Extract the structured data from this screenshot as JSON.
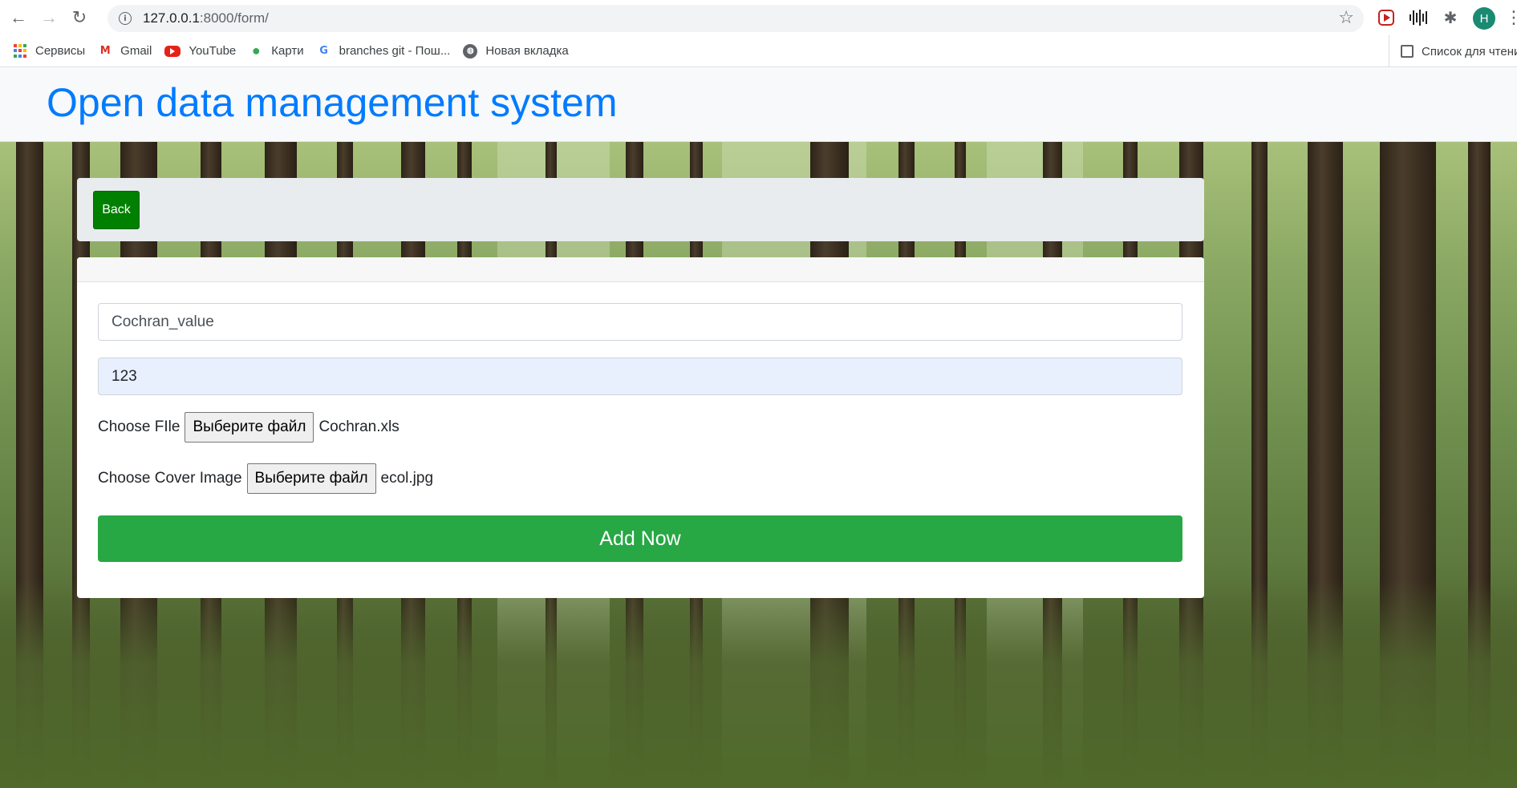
{
  "browser": {
    "url_host": "127.0.0.1",
    "url_path": ":8000/form/",
    "avatar_letter": "H",
    "bookmarks": [
      {
        "label": "Сервисы",
        "icon": "apps-grid-icon"
      },
      {
        "label": "Gmail",
        "icon": "gmail-icon"
      },
      {
        "label": "YouTube",
        "icon": "youtube-icon"
      },
      {
        "label": "Карти",
        "icon": "maps-pin-icon"
      },
      {
        "label": "branches git - Пош...",
        "icon": "google-icon"
      },
      {
        "label": "Новая вкладка",
        "icon": "globe-icon"
      }
    ],
    "reading_list_label": "Список для чтения"
  },
  "site": {
    "title": "Open data management system"
  },
  "nav": {
    "back_label": "Back"
  },
  "form": {
    "name_value": "Cochran_value",
    "number_value": "123",
    "file_label": "Choose FIle",
    "file_button": "Выберите файл",
    "file_name": "Cochran.xls",
    "cover_label": "Choose Cover Image",
    "cover_button": "Выберите файл",
    "cover_name": "ecol.jpg",
    "submit_label": "Add Now"
  },
  "colors": {
    "title_blue": "#007bff",
    "back_green": "#008000",
    "submit_green": "#28a745",
    "autofill_blue": "#e8f0fe"
  }
}
